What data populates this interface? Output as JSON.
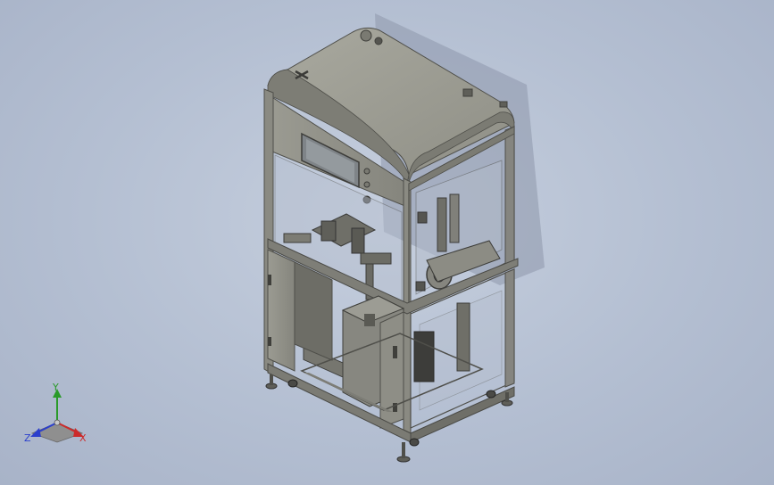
{
  "viewport": {
    "background_top": "#c6cfde",
    "background_bottom": "#a8b3c8"
  },
  "model": {
    "frame_color": "#8d8d83",
    "frame_dark": "#5b5b55",
    "panel_color": "#a3a39a",
    "screen_color": "#8a8d8f"
  },
  "triad": {
    "x_label": "X",
    "y_label": "Y",
    "z_label": "Z",
    "x_color": "#cc2b2b",
    "y_color": "#2a9a2a",
    "z_color": "#2b3fcc"
  }
}
